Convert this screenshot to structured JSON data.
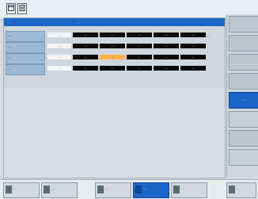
{
  "title_strip": {
    "left": "...",
    "right": "..."
  },
  "columns": [
    "...",
    "...",
    "...",
    "...",
    "...",
    "..."
  ],
  "rows": [
    {
      "label": "...",
      "sub": "...",
      "cells": [
        "...",
        "...",
        "...",
        "...",
        "...",
        "..."
      ]
    },
    {
      "label": "...",
      "sub": "...",
      "cells": [
        "...",
        "...",
        "...",
        "...",
        "...",
        "..."
      ]
    },
    {
      "label": "...",
      "sub": "...",
      "cells": [
        "...",
        "...",
        "...",
        "...",
        "...",
        "..."
      ]
    },
    {
      "label": "...",
      "sub": "...",
      "cells": [
        "...",
        "...",
        "...",
        "...",
        "...",
        "..."
      ]
    }
  ],
  "right_softkeys": [
    {
      "label": "..."
    },
    {
      "label": "..."
    },
    {
      "label": "..."
    },
    {
      "label": "..."
    },
    {
      "label": "..."
    },
    {
      "label": ""
    },
    {
      "label": "..."
    },
    {
      "label": ""
    }
  ],
  "bottom_softkeys": [
    {
      "label": "..."
    },
    {
      "label": "..."
    },
    {
      "label": "..."
    },
    {
      "label": "..."
    },
    {
      "label": "..."
    },
    {
      "label": "..."
    }
  ],
  "colors": {
    "accent": "#1b64c8",
    "cell_black": "#0b0b0b",
    "cell_orange": "#ffb24a"
  },
  "icons": [
    "window-icon",
    "document-icon"
  ]
}
